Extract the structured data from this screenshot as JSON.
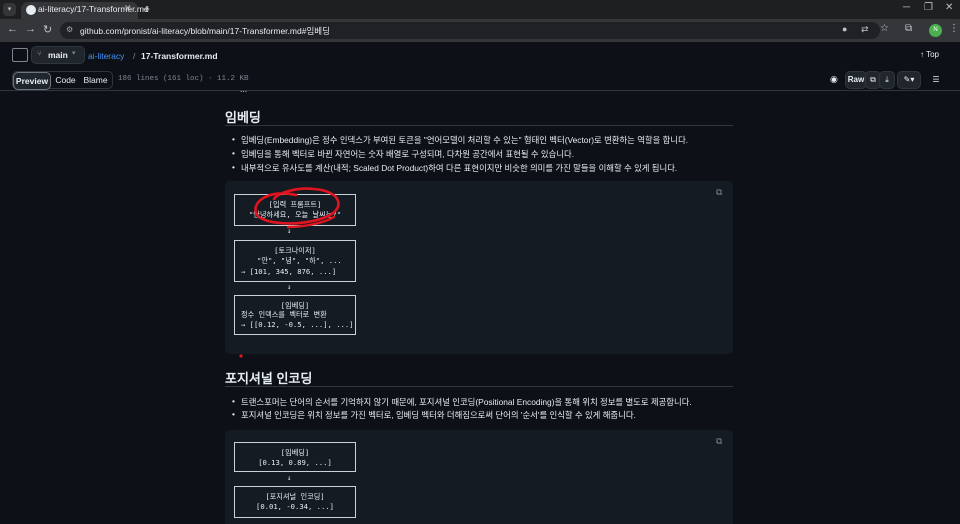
{
  "browser": {
    "tab_title": "ai-literacy/17-Transformer.md",
    "new_tab": "+",
    "url": "github.com/pronist/ai-literacy/blob/main/17-Transformer.md#임베딩",
    "profile_initials": "N",
    "accent": "#4caf50"
  },
  "repo_header": {
    "branch": "main",
    "repo": "ai-literacy",
    "separator": "/",
    "file": "17-Transformer.md",
    "top": "Top"
  },
  "file_toolbar": {
    "tabs": [
      "Preview",
      "Code",
      "Blame"
    ],
    "active_tab": "Preview",
    "meta": "186 lines (161 loc) · 11.2 KB",
    "raw": "Raw"
  },
  "article": {
    "cut_text": "...",
    "section1": {
      "heading": "임베딩",
      "bullets": [
        "임베딩(Embedding)은 정수 인덱스가 부여된 토큰을 \"언어모델이 처리할 수 있는\" 형태인 벡터(Vector)로 변환하는 역할을 합니다.",
        "임베딩을 통해 벡터로 바뀐 자연어는 숫자 배열로 구성되며, 다차원 공간에서 표현될 수 있습니다.",
        "내부적으로 유사도를 계산(내적; Scaled Dot Product)하여 다른 표현이지만 비슷한 의미를 가진 말들을 이해할 수 있게 됩니다."
      ],
      "diagram": {
        "box1": [
          "[입력 프롬프트]",
          "\"안녕하세요, 오늘 날씨는?\""
        ],
        "box2": [
          "[토크나이저]",
          "\"안\", \"녕\", \"하\", ...",
          "→ [101, 345, 876, ...]"
        ],
        "box3": [
          "[임베딩]",
          "정수 인덱스를 벡터로 변환",
          "→ [[0.12, -0.5, ...], ...]"
        ],
        "arrow": "↓"
      }
    },
    "section2": {
      "heading": "포지셔널 인코딩",
      "bullets": [
        "트랜스포머는 단어의 순서를 기억하지 않기 때문에, 포지셔널 인코딩(Positional Encoding)을 통해 위치 정보를 별도로 제공합니다.",
        "포지셔널 인코딩은 위치 정보를 가진 벡터로, 임베딩 벡터와 더해짐으로써 단어의 '순서'를 인식할 수 있게 해줍니다."
      ],
      "diagram": {
        "box1": [
          "[임베딩]",
          "[0.13, 0.89, ...]"
        ],
        "box2": [
          "[포지셔널 인코딩]",
          "[0.01, -0.34, ...]"
        ],
        "arrow": "↓"
      }
    }
  },
  "annotation_color": "#e0141f"
}
